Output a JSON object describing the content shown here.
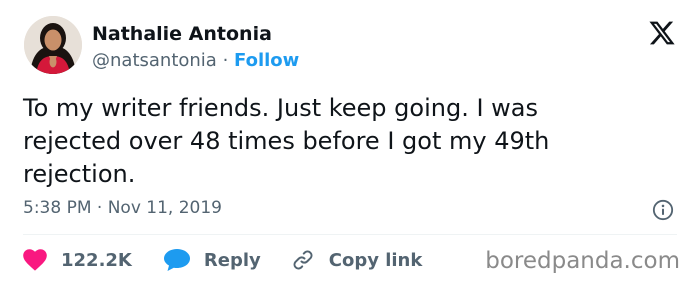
{
  "author": {
    "display_name": "Nathalie Antonia",
    "handle": "@natsantonia",
    "separator": "·",
    "follow_label": "Follow"
  },
  "tweet": {
    "text": "To my writer friends. Just keep going. I was rejected over 48 times before I got my 49th rejection.",
    "timestamp": "5:38 PM · Nov 11, 2019"
  },
  "actions": {
    "likes_count": "122.2K",
    "reply_label": "Reply",
    "copy_link_label": "Copy link"
  },
  "watermark": "boredpanda.com",
  "icons": {
    "logo": "x-logo-icon",
    "info": "info-icon",
    "like": "heart-icon",
    "reply": "speech-bubble-icon",
    "copy": "link-icon"
  },
  "colors": {
    "text": "#0f1419",
    "secondary": "#536471",
    "follow": "#1d9bf0",
    "heart": "#f91880",
    "reply": "#1d9bf0"
  }
}
